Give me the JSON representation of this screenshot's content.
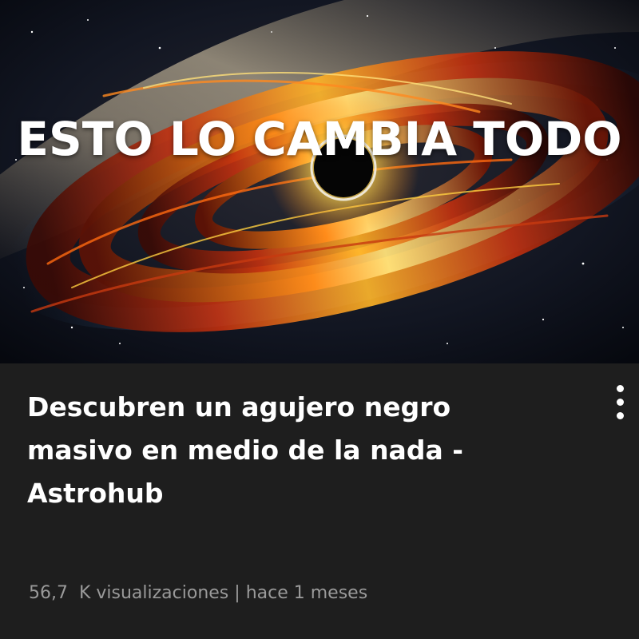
{
  "video": {
    "thumbnail_overlay_text": "ESTO LO CAMBIA TODO",
    "thumbnail_alt": "black-hole-illustration",
    "title": "Descubren un agujero negro masivo en medio de la nada - Astrohub",
    "views": "56,7  K visualizaciones",
    "separator": "|",
    "uploaded": "hace 1 meses"
  },
  "icons": {
    "menu": "more-vertical-icon"
  },
  "colors": {
    "background": "#1e1e1e",
    "title": "#ffffff",
    "meta": "#9a9a9a"
  }
}
